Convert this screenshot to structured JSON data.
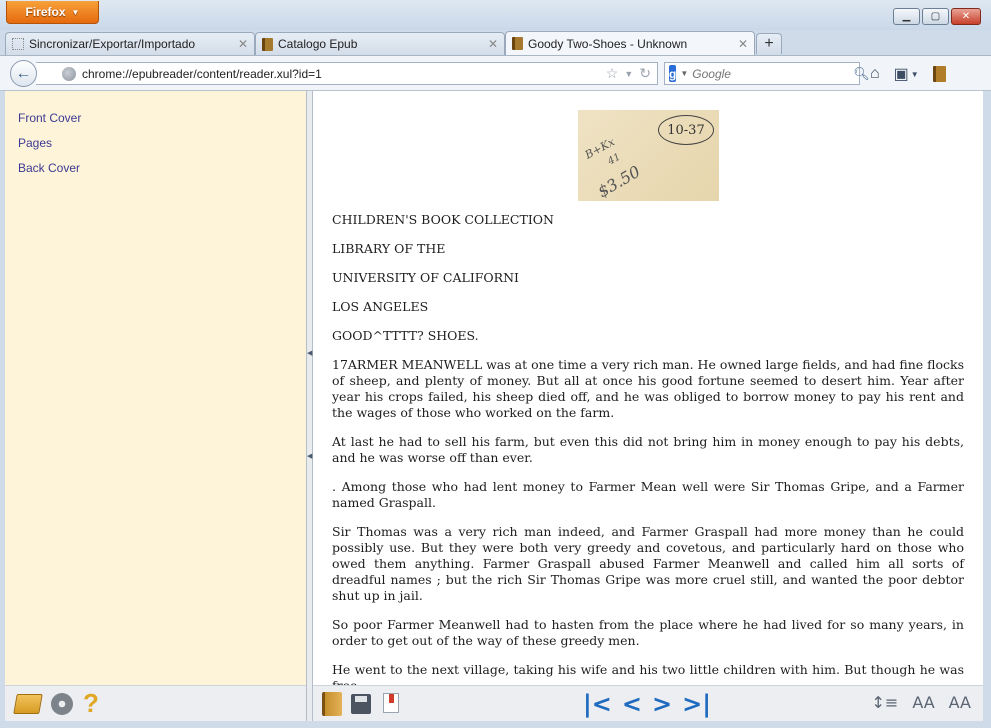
{
  "browser": {
    "menu_button": "Firefox",
    "window_controls": {
      "minimize": "▁",
      "maximize": "▢",
      "close": "✕"
    }
  },
  "tabs": [
    {
      "label": "Sincronizar/Exportar/Importado",
      "icon": "blank-page-icon"
    },
    {
      "label": "Catalogo Epub",
      "icon": "book-icon"
    },
    {
      "label": "Goody Two-Shoes - Unknown",
      "icon": "book-icon",
      "active": true
    }
  ],
  "navbar": {
    "url": "chrome://epubreader/content/reader.xul?id=1",
    "search_placeholder": "Google",
    "search_engine_letter": "g"
  },
  "sidebar": {
    "toc": [
      "Front Cover",
      "Pages",
      "Back Cover"
    ]
  },
  "reader": {
    "stamp": {
      "circled": "10-37",
      "scrawl1": "B+Kx",
      "scrawl2": "41",
      "scrawl3": "$3.50"
    },
    "paragraphs": [
      "CHILDREN'S BOOK COLLECTION",
      "LIBRARY OF THE",
      "UNIVERSITY OF CALIFORNI",
      "LOS ANGELES",
      "GOOD^TTTT? SHOES.",
      "17ARMER MEANWELL was at one time a very rich man. He owned large fields, and had fine flocks of sheep, and plenty of money. But all at once his good fortune seemed to desert him. Year after year his crops failed, his sheep died off, and he was obliged to borrow money to pay his rent and the wages of those who worked on the farm.",
      "At last he had to sell his farm, but even this did not bring him in money enough to pay his debts, and he was worse off than ever.",
      ". Among those who had lent money to Farmer Mean well were Sir Thomas Gripe, and a Farmer named Graspall.",
      "Sir Thomas was a very rich man indeed, and Farmer Graspall had more money than he could possibly use. But they were both very greedy and covetous, and particularly hard on those who owed them anything. Farmer Graspall abused Farmer Meanwell and called him all sorts of dreadful names ; but the rich Sir Thomas Gripe was more cruel still, and wanted the poor debtor shut up in jail.",
      "So poor Farmer Meanwell had to hasten from the place where he had lived for so many years, in order to get out of the way of these greedy men.",
      "He went to the next village, taking his wife and his two little children with him. But though he was free"
    ]
  },
  "toolbar": {
    "first": "|<",
    "prev": "<",
    "next": ">",
    "last": ">|",
    "help": "?",
    "font_smaller": "AA",
    "font_larger": "AA"
  }
}
